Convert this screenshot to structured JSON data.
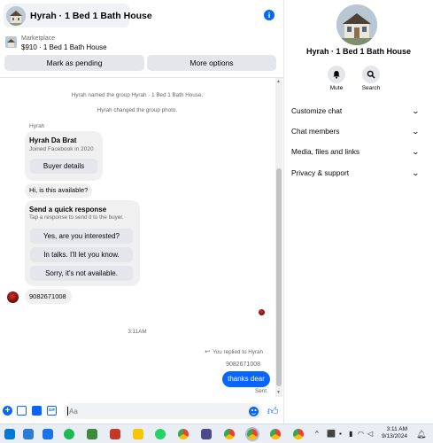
{
  "header": {
    "title": "Hyrah · 1 Bed 1 Bath House"
  },
  "listing": {
    "source": "Marketplace",
    "name": "$910 · 1 Bed 1 Bath House",
    "mark_pending_label": "Mark as pending",
    "more_options_label": "More options"
  },
  "messages": {
    "system_1": "Hyrah named the group Hyrah · 1 Bed 1 Bath House.",
    "system_2": "Hyrah changed the group photo.",
    "sender_name": "Hyrah",
    "profile_card": {
      "name": "Hyrah Da Brat",
      "subtitle": "Joined Facebook in 2020",
      "button_label": "Buyer details"
    },
    "inquiry": "Hi, is this available?",
    "quick_response": {
      "title": "Send a quick response",
      "subtitle": "Tap a response to send it to the buyer.",
      "options": [
        "Yes, are you interested?",
        "In talks. I'll let you know.",
        "Sorry, it's not available."
      ]
    },
    "phone_message": "9082671008",
    "timestamp": "3:11AM",
    "reply_note": "You replied to Hyrah",
    "quoted_text": "9082671008",
    "sent_message": "thanks dear",
    "sent_status": "Sent"
  },
  "composer": {
    "placeholder": "Aa"
  },
  "details": {
    "title": "Hyrah · 1 Bed 1 Bath House",
    "mute_label": "Mute",
    "search_label": "Search",
    "sections": [
      "Customize chat",
      "Chat members",
      "Media, files and links",
      "Privacy & support"
    ]
  },
  "taskbar": {
    "time": "3:11 AM",
    "date": "9/13/2024"
  },
  "colors": {
    "accent": "#0866ff",
    "bubble_gray": "#f0f0f0",
    "button_gray": "#e4e6eb",
    "secondary_text": "#65676b"
  },
  "icons": {
    "info": "info-icon",
    "mute": "bell-icon",
    "search": "search-icon",
    "composer": [
      "plus-icon",
      "photo-icon",
      "sticker-icon",
      "gif-icon",
      "emoji-icon",
      "like-icon"
    ],
    "section_chevron": "chevron-down-icon"
  }
}
